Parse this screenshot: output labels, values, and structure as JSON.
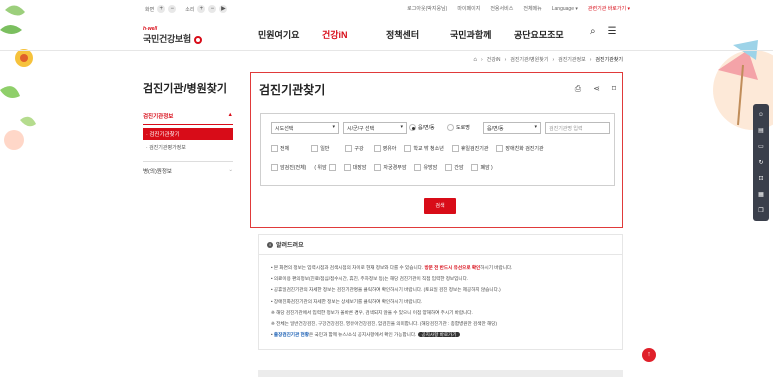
{
  "utilbar": {
    "zoom_label": "화면",
    "print_label": "소리",
    "links": [
      "로그아웃(박지웅님)",
      "마이페이지",
      "전용서비스",
      "전체메뉴",
      "Language ▾"
    ],
    "related_site": "관련기관 바로가기 ▾"
  },
  "logo": {
    "small": "h-well",
    "big": "국민건강보험"
  },
  "gnb": [
    "민원여기요",
    "건강iN",
    "정책센터",
    "국민과함께",
    "공단요모조모"
  ],
  "breadcrumb": [
    "건강iN",
    "검진기관/병원찾기",
    "검진기관정보",
    "검진기관찾기"
  ],
  "lnb": {
    "title": "검진기관/병원찾기",
    "head": "검진기관정보",
    "active": "검진기관찾기",
    "sub": "검진기관평가정보",
    "item2": "병(의)원정보"
  },
  "panel": {
    "title": "검진기관찾기",
    "sido": "시도선택",
    "sigungu": "시/군/구 선택",
    "radio1": "읍/면/동",
    "radio2": "도로명",
    "eup": "읍/면/동",
    "placeholder": "검진기관명 입력",
    "row1": [
      "전체",
      "일반",
      "구강",
      "영유아",
      "학교 밖 청소년",
      "휴일검진기관",
      "장애친화 검진기관"
    ],
    "row2": [
      "암검진(전체)",
      "( 위암",
      "대장암",
      "자궁경부암",
      "유방암",
      "간암",
      "폐암 )"
    ],
    "search": "검색"
  },
  "notice": {
    "title": "알려드려요",
    "lines": [
      {
        "pre": "본 화면의 정보는 입력시점과 검색시점의 차이로 현재 정보와 다를 수 있습니다. ",
        "em": "방문 전 반드시 유선으로 확인",
        "post": "하시기 바랍니다."
      },
      {
        "pre": "의료이용 편의정보(진료/점심/접수시간, 휴진, 주차정보 등)는 해당 검진기관이 직접 입력한 정보입니다.",
        "em": "",
        "post": ""
      },
      {
        "pre": "공휴일검진기관의 자세한 정보는 검진기관명을 클릭하여 확인하시기 바랍니다. (토요일 검진 정보는 제공하지 않습니다.)",
        "em": "",
        "post": ""
      },
      {
        "pre": "장애친화검진기관의 자세한 정보는 상세보기를 클릭하여 확인하시기 바랍니다.",
        "em": "",
        "post": ""
      },
      {
        "pre": "※ 해당 검진기관에서 입력한 정보가 올바른 경우, 검색되지 않을 수 있으니 이점 양해하여 주시기 바랍니다.",
        "em": "",
        "post": ""
      },
      {
        "pre": "※ 전체는 일반건강검진, 구강건강검진, 영유아건강검진, 암검진을 의미합니다. (해당검진기관 : 종합병원만 검색만 해당)",
        "em": "",
        "post": ""
      },
      {
        "pre": "",
        "blue": "출장검진기관 현황",
        "post": "은 국민과 함께 뉴스/소식 공지사항에서 확인 가능합니다.",
        "pill": "공지사항 바로가기"
      }
    ]
  },
  "colors": {
    "brand": "#d80c18",
    "quick_bg": "#3a3f4b"
  }
}
